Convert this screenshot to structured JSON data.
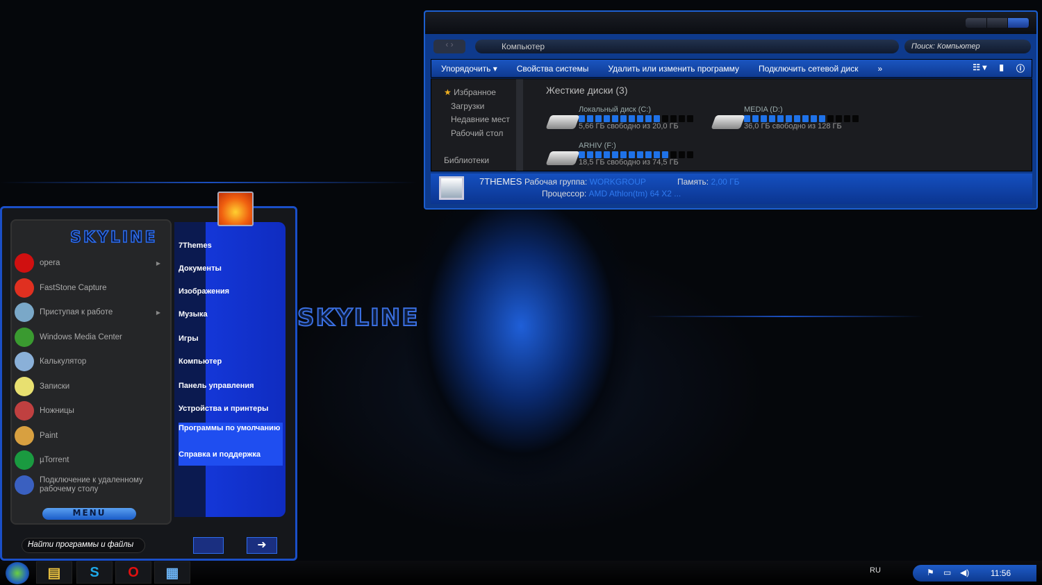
{
  "desktop": {
    "logo_text": "SKYLINE"
  },
  "explorer": {
    "address": "Компьютер",
    "search_placeholder": "Поиск: Компьютер",
    "toolbar": [
      "Упорядочить ▾",
      "Свойства системы",
      "Удалить или изменить программу",
      "Подключить сетевой диск",
      "»"
    ],
    "nav": [
      "Избранное",
      "Загрузки",
      "Недавние мест",
      "Рабочий стол",
      "",
      "Библиотеки"
    ],
    "section": "Жесткие диски (3)",
    "drives": [
      {
        "name": "Локальный диск (C:)",
        "info": "5,66 ГБ свободно из 20,0 ГБ",
        "used_fraction": 0.72
      },
      {
        "name": "MEDIA (D:)",
        "info": "36,0 ГБ свободно из 128 ГБ",
        "used_fraction": 0.72
      },
      {
        "name": "ARHIV (F:)",
        "info": "18,5 ГБ свободно из 74,5 ГБ",
        "used_fraction": 0.75
      }
    ],
    "details": {
      "computer": "7THEMES",
      "workgroup_label": "Рабочая группа:",
      "workgroup": "WORKGROUP",
      "memory_label": "Память:",
      "memory": "2,00 ГБ",
      "cpu_label": "Процессор:",
      "cpu": "AMD Athlon(tm) 64 X2 ..."
    }
  },
  "start_menu": {
    "logo": "SKYLINE",
    "programs": [
      {
        "label": "opera",
        "submenu": true,
        "color": "#d01010"
      },
      {
        "label": "FastStone Capture",
        "submenu": false,
        "color": "#e03020"
      },
      {
        "label": "Приступая к работе",
        "submenu": true,
        "color": "#7aa8c8"
      },
      {
        "label": "Windows Media Center",
        "submenu": false,
        "color": "#3a9a30"
      },
      {
        "label": "Калькулятор",
        "submenu": false,
        "color": "#8ab0d8"
      },
      {
        "label": "Записки",
        "submenu": false,
        "color": "#e8e070"
      },
      {
        "label": "Ножницы",
        "submenu": false,
        "color": "#c04040"
      },
      {
        "label": "Paint",
        "submenu": false,
        "color": "#d8a040"
      },
      {
        "label": "µTorrent",
        "submenu": false,
        "color": "#1a9a40"
      },
      {
        "label": "Подключение к удаленному рабочему столу",
        "submenu": false,
        "color": "#3a60c0"
      }
    ],
    "places": [
      "7Themes",
      "Документы",
      "Изображения",
      "Музыка",
      "Игры",
      "Компьютер",
      "Панель управления",
      "Устройства и принтеры",
      "Программы по умолчанию",
      "Справка и поддержка"
    ],
    "menu_button": "MENU",
    "search_placeholder": "Найти программы и файлы"
  },
  "taskbar": {
    "pinned": [
      "explorer",
      "skype",
      "opera",
      "control-panel"
    ],
    "language": "RU",
    "clock": "11:56"
  }
}
